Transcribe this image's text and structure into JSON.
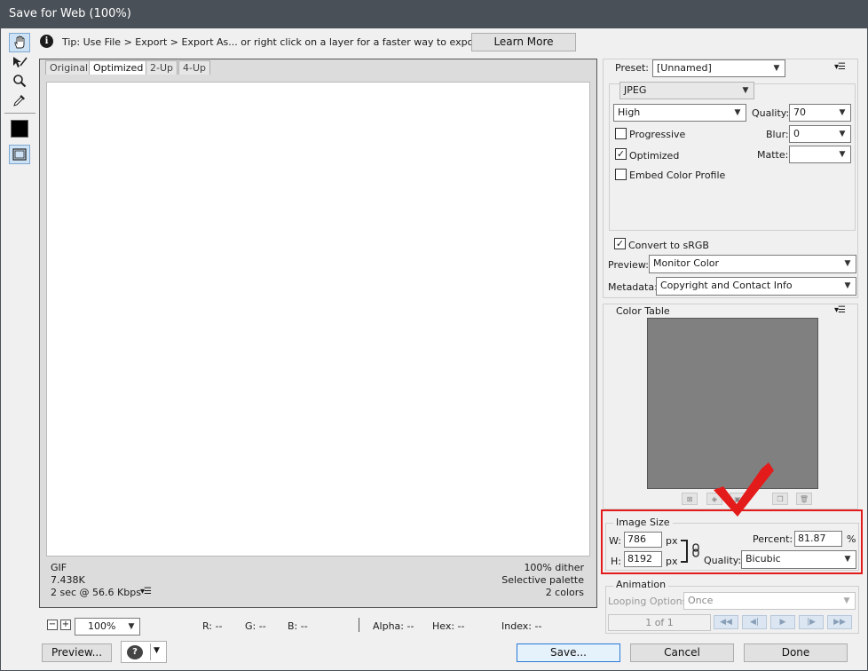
{
  "window": {
    "title": "Save for Web (100%)"
  },
  "tip": {
    "text": "Tip: Use File > Export > Export As...  or right click on a layer for a faster way to export assets",
    "learn_more": "Learn More"
  },
  "tabs": [
    "Original",
    "Optimized",
    "2-Up",
    "4-Up"
  ],
  "preview_info": {
    "format": "GIF",
    "size": "7.438K",
    "time": "2 sec @ 56.6 Kbps",
    "dither": "100% dither",
    "palette": "Selective palette",
    "colors": "2 colors"
  },
  "status": {
    "zoom": "100%",
    "r": "R: --",
    "g": "G: --",
    "b": "B: --",
    "alpha": "Alpha: --",
    "hex": "Hex: --",
    "index": "Index: --"
  },
  "buttons": {
    "preview": "Preview...",
    "save": "Save...",
    "cancel": "Cancel",
    "done": "Done"
  },
  "settings": {
    "preset_label": "Preset:",
    "preset_value": "[Unnamed]",
    "format": "JPEG",
    "quality_preset": "High",
    "quality_label": "Quality:",
    "quality_value": "70",
    "blur_label": "Blur:",
    "blur_value": "0",
    "matte_label": "Matte:",
    "matte_value": "",
    "progressive_label": "Progressive",
    "progressive_checked": false,
    "optimized_label": "Optimized",
    "optimized_checked": true,
    "embed_label": "Embed Color Profile",
    "embed_checked": false,
    "srgb_label": "Convert to sRGB",
    "srgb_checked": true,
    "preview_label": "Preview:",
    "preview_value": "Monitor Color",
    "metadata_label": "Metadata:",
    "metadata_value": "Copyright and Contact Info"
  },
  "color_table": {
    "title": "Color Table",
    "swatch_color": "#808080"
  },
  "image_size": {
    "title": "Image Size",
    "w_label": "W:",
    "w_value": "786",
    "h_label": "H:",
    "h_value": "8192",
    "unit": "px",
    "percent_label": "Percent:",
    "percent_value": "81.87",
    "percent_unit": "%",
    "quality_label": "Quality:",
    "quality_value": "Bicubic"
  },
  "animation": {
    "title": "Animation",
    "looping_label": "Looping Options:",
    "looping_value": "Once",
    "frame": "1 of 1"
  },
  "colors": {
    "annotation": "#e41b1b",
    "titlebar": "#4a5057",
    "accent": "#2a7ad6"
  }
}
